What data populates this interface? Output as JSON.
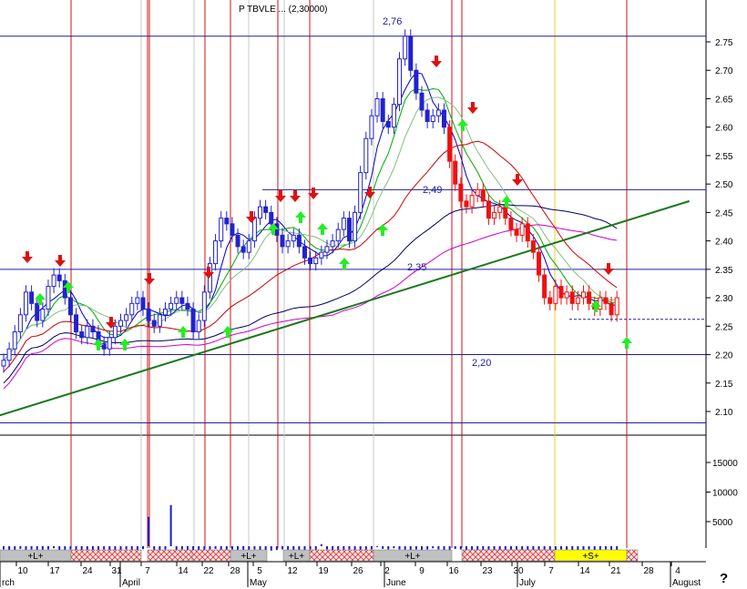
{
  "title": "P TBVLE ... (2,30000)",
  "chart_data": {
    "type": "candlestick",
    "price_axis": {
      "ticks": [
        2.75,
        2.7,
        2.65,
        2.6,
        2.55,
        2.5,
        2.45,
        2.4,
        2.35,
        2.3,
        2.25,
        2.2,
        2.15,
        2.1
      ],
      "labels": [
        "2.75",
        "2.70",
        "2.65",
        "2.60",
        "2.55",
        "2.50",
        "2.45",
        "2.40",
        "2.35",
        "2.30",
        "2.25",
        "2.20",
        "2.15",
        "2.10"
      ],
      "range": [
        2.06,
        2.81
      ]
    },
    "volume_axis": {
      "ticks": [
        15000,
        10000,
        5000
      ],
      "labels": [
        "15000",
        "10000",
        "5000"
      ]
    },
    "date_ticks": [
      "10",
      "17",
      "24",
      "31",
      "7",
      "14",
      "22",
      "28",
      "5",
      "12",
      "19",
      "26",
      "2",
      "9",
      "16",
      "23",
      "30",
      "7",
      "14",
      "21",
      "28",
      "4"
    ],
    "month_labels": [
      "rch",
      "April",
      "May",
      "June",
      "July",
      "August"
    ],
    "levels": [
      {
        "label": "2,76",
        "value": 2.76
      },
      {
        "label": "2,49",
        "value": 2.49
      },
      {
        "label": "2,35",
        "value": 2.35
      },
      {
        "label": "2,20",
        "value": 2.2
      }
    ],
    "bands": [
      {
        "label": "+L+",
        "kind": "long"
      },
      {
        "label": "",
        "kind": "hatch"
      },
      {
        "label": "",
        "kind": "hatch"
      },
      {
        "label": "",
        "kind": "hatch"
      },
      {
        "label": "+L+",
        "kind": "long"
      },
      {
        "label": "+L+",
        "kind": "long"
      },
      {
        "label": "",
        "kind": "hatch"
      },
      {
        "label": "+L+",
        "kind": "long"
      },
      {
        "label": "",
        "kind": "hatch"
      },
      {
        "label": "",
        "kind": "hatch"
      },
      {
        "label": "+S+",
        "kind": "short"
      },
      {
        "label": "",
        "kind": "hatch"
      }
    ],
    "closes": [
      2.19,
      2.21,
      2.24,
      2.27,
      2.31,
      2.29,
      2.26,
      2.28,
      2.32,
      2.34,
      2.33,
      2.3,
      2.27,
      2.24,
      2.23,
      2.25,
      2.24,
      2.22,
      2.21,
      2.23,
      2.25,
      2.26,
      2.27,
      2.29,
      2.3,
      2.28,
      2.26,
      2.25,
      2.27,
      2.28,
      2.29,
      2.3,
      2.29,
      2.28,
      2.24,
      2.26,
      2.31,
      2.36,
      2.4,
      2.44,
      2.43,
      2.41,
      2.39,
      2.38,
      2.4,
      2.44,
      2.46,
      2.45,
      2.43,
      2.41,
      2.39,
      2.4,
      2.41,
      2.39,
      2.37,
      2.36,
      2.37,
      2.38,
      2.39,
      2.4,
      2.42,
      2.44,
      2.4,
      2.45,
      2.52,
      2.58,
      2.62,
      2.65,
      2.61,
      2.6,
      2.64,
      2.72,
      2.76,
      2.7,
      2.66,
      2.63,
      2.61,
      2.62,
      2.63,
      2.6,
      2.54,
      2.5,
      2.47,
      2.46,
      2.48,
      2.49,
      2.47,
      2.44,
      2.45,
      2.46,
      2.44,
      2.42,
      2.41,
      2.43,
      2.4,
      2.38,
      2.34,
      2.3,
      2.29,
      2.32,
      2.3,
      2.31,
      2.29,
      2.3,
      2.31,
      2.29,
      2.28,
      2.3,
      2.29,
      2.27,
      2.3
    ],
    "volumes": [
      300,
      200,
      150,
      400,
      100,
      300,
      200,
      250,
      300,
      500,
      200,
      150,
      300,
      200,
      100,
      250,
      200,
      150,
      300,
      200,
      100,
      200,
      300,
      250,
      200,
      350,
      5800,
      200,
      150,
      300,
      7800,
      200,
      300,
      250,
      200,
      150,
      100,
      300,
      400,
      200,
      250,
      300,
      200,
      150,
      250,
      300,
      200,
      150,
      100,
      200,
      300,
      250,
      200,
      150,
      200,
      300,
      250,
      1200,
      300,
      200,
      150,
      250,
      300,
      200,
      150,
      250,
      300,
      700,
      400,
      300,
      500,
      300,
      250,
      200,
      300,
      200,
      300,
      500,
      300,
      200,
      250,
      400,
      300,
      200,
      150,
      200,
      250,
      300,
      200,
      150,
      250,
      200,
      300,
      250,
      200,
      150,
      200,
      300,
      250,
      200,
      300,
      250,
      200,
      150,
      200,
      300,
      200,
      250,
      300,
      200,
      150
    ],
    "ma_series": [
      {
        "color": "#0000cc"
      },
      {
        "color": "#00aa00"
      },
      {
        "color": "#80c080"
      },
      {
        "color": "#cc0000"
      },
      {
        "color": "#000060"
      },
      {
        "color": "#cc00cc"
      }
    ],
    "trendline": {
      "from": [
        -5,
        2.08
      ],
      "to": [
        123,
        2.47
      ]
    }
  }
}
